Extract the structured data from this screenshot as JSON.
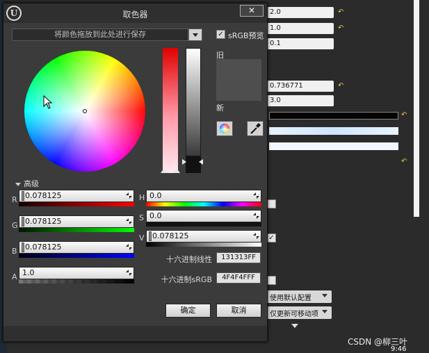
{
  "dialog": {
    "title": "取色器",
    "close_glyph": "✕",
    "logo_glyph": "U",
    "save_placeholder": "将颜色拖放到此处进行保存",
    "srgb_label": "sRGB预览",
    "srgb_checked": "✓",
    "old_label": "旧",
    "new_label": "新",
    "old_color": "#4f4f4f",
    "new_color": "#4e4e4e",
    "advanced_label": "高级",
    "channels": {
      "r": {
        "label": "R",
        "value": "0.078125"
      },
      "g": {
        "label": "G",
        "value": "0.078125"
      },
      "b": {
        "label": "B",
        "value": "0.078125"
      },
      "a": {
        "label": "A",
        "value": "1.0"
      },
      "h": {
        "label": "H",
        "value": "0.0"
      },
      "s": {
        "label": "S",
        "value": "0.0"
      },
      "v": {
        "label": "V",
        "value": "0.078125"
      }
    },
    "hex_linear_label": "十六进制线性",
    "hex_linear_value": "131313FF",
    "hex_srgb_label": "十六进制sRGB",
    "hex_srgb_value": "4F4F4FFF",
    "ok_label": "确定",
    "cancel_label": "取消"
  },
  "background_panel": {
    "fields": [
      "2.0",
      "1.0",
      "0.1",
      "0.736771",
      "3.0"
    ],
    "reset_glyph": "↶",
    "checkbox_mark": "✓",
    "dropdown_1": "使用默认配置",
    "dropdown_2": "仅更新可移动项",
    "watermark": "CSDN @柳三叶",
    "time": "9:46"
  }
}
